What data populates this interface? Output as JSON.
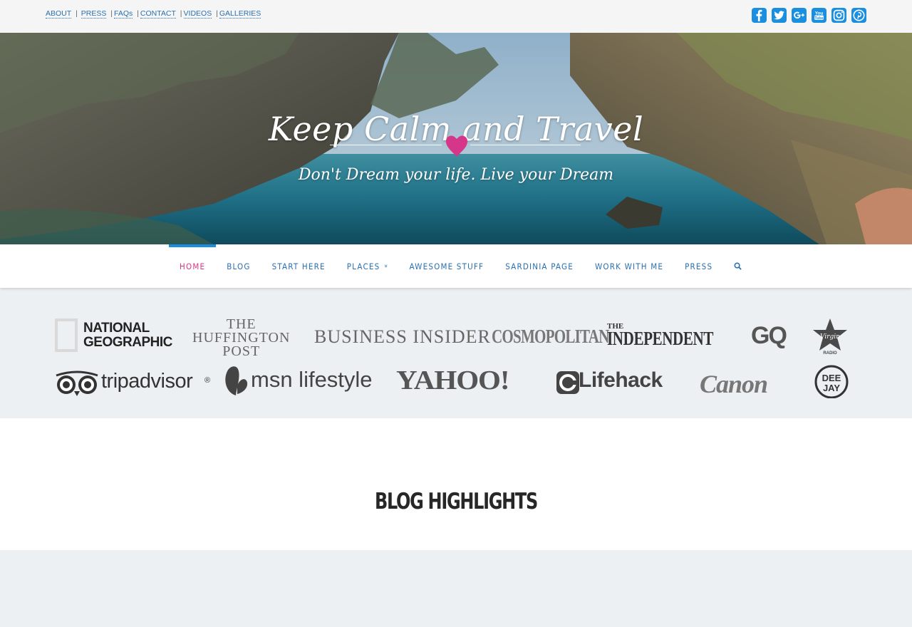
{
  "topbar": {
    "links": [
      "ABOUT",
      "PRESS",
      "FAQs",
      "CONTACT",
      "VIDEOS",
      "GALLERIES"
    ],
    "separators": [
      " | ",
      " |",
      " |",
      " |",
      " |"
    ],
    "social": [
      "facebook-icon",
      "twitter-icon",
      "google-plus-icon",
      "youtube-icon",
      "instagram-icon",
      "pinterest-icon"
    ]
  },
  "hero": {
    "title": "Keep Calm and Travel",
    "tagline": "Don't Dream your life. Live your Dream"
  },
  "nav": {
    "items": [
      "HOME",
      "BLOG",
      "START HERE",
      "PLACES",
      "AWESOME STUFF",
      "SARDINIA PAGE",
      "WORK WITH ME",
      "PRESS"
    ],
    "places_chevron": "»",
    "active": "HOME",
    "search_icon": "search-icon"
  },
  "press": {
    "national_geographic": "NATIONAL\nGEOGRAPHIC",
    "huffington": "THE\nHUFFINGTON\nPOST",
    "business_insider": "BUSINESS INSIDER",
    "cosmopolitan": "COSMOPOLITAN",
    "independent_the": "THE",
    "independent": "INDEPENDENT",
    "gq": "GQ",
    "virgin": "Virgin\nRADIO",
    "tripadvisor": "tripadvisor",
    "tripadvisor_reg": "®",
    "msn": "msn lifestyle",
    "yahoo": "YAHOO!",
    "lifehack": "Lifehack",
    "canon": "Canon",
    "deejay": "DEE\nJAY"
  },
  "section": {
    "title": "BLOG HIGHLIGHTS"
  },
  "colors": {
    "accent": "#1a8fe0",
    "active_nav": "#d6368a",
    "nav_link": "#2a6fb0",
    "band": "#ecf0f2"
  }
}
